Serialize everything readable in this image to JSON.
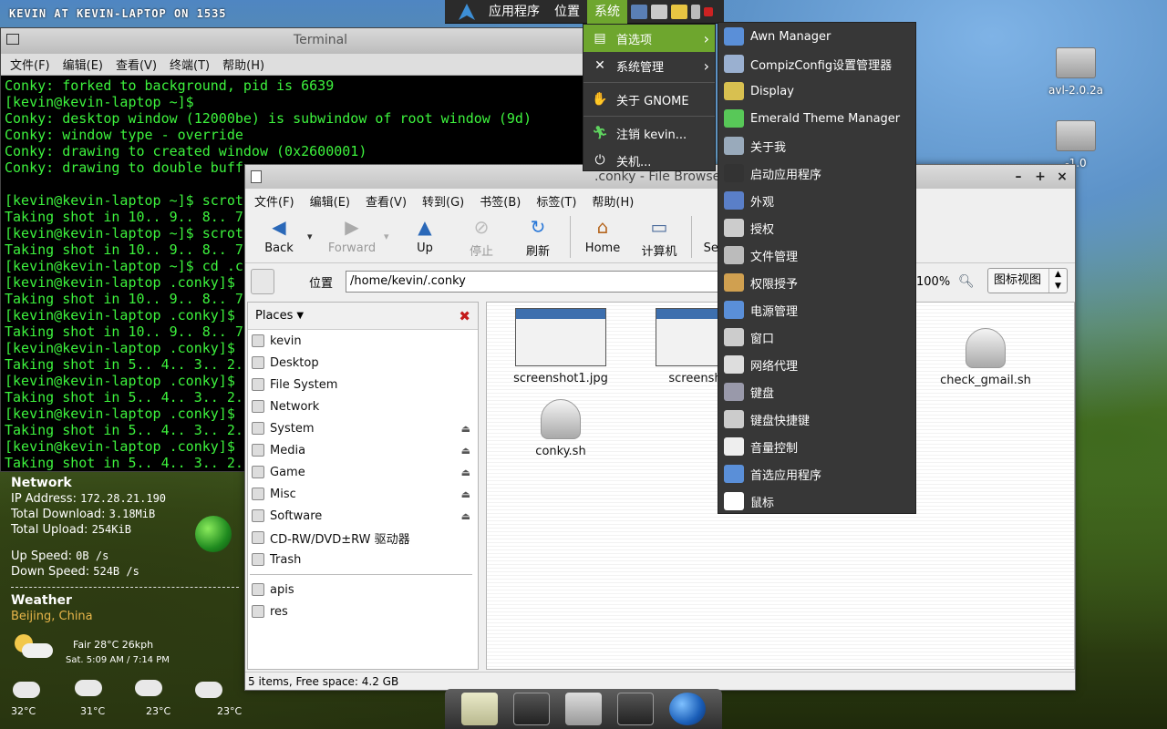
{
  "desktop": {
    "user_label": "KEVIN AT KEVIN-LAPTOP ON 1535"
  },
  "top_panel": {
    "applications": "应用程序",
    "places": "位置",
    "system": "系统"
  },
  "terminal": {
    "title": "Terminal",
    "menu": [
      "文件(F)",
      "编辑(E)",
      "查看(V)",
      "终端(T)",
      "帮助(H)"
    ],
    "lines": [
      "Conky: forked to background, pid is 6639",
      "[kevin@kevin-laptop ~]$",
      "Conky: desktop window (12000be) is subwindow of root window (9d)",
      "Conky: window type - override",
      "Conky: drawing to created window (0x2600001)",
      "Conky: drawing to double buff",
      "",
      "[kevin@kevin-laptop ~]$ scrot",
      "Taking shot in 10.. 9.. 8.. 7",
      "[kevin@kevin-laptop ~]$ scrot",
      "Taking shot in 10.. 9.. 8.. 7",
      "[kevin@kevin-laptop ~]$ cd .c",
      "[kevin@kevin-laptop .conky]$",
      "Taking shot in 10.. 9.. 8.. 7",
      "[kevin@kevin-laptop .conky]$",
      "Taking shot in 10.. 9.. 8.. 7",
      "[kevin@kevin-laptop .conky]$",
      "Taking shot in 5.. 4.. 3.. 2.",
      "[kevin@kevin-laptop .conky]$",
      "Taking shot in 5.. 4.. 3.. 2.",
      "[kevin@kevin-laptop .conky]$",
      "Taking shot in 5.. 4.. 3.. 2.",
      "[kevin@kevin-laptop .conky]$",
      "Taking shot in 5.. 4.. 3.. 2."
    ]
  },
  "conky": {
    "network_header": "Network",
    "ip_label": "IP Address:",
    "ip_value": "172.28.21.190",
    "download_label": "Total Download:",
    "download_value": "3.18MiB",
    "upload_label": "Total Upload:",
    "upload_value": "254KiB",
    "up_speed_label": "Up Speed:",
    "up_speed_value": "0B   /s",
    "down_speed_label": "Down Speed:",
    "down_speed_value": "524B   /s",
    "weather_header": "Weather",
    "location": "Beijing, China",
    "current": "Fair  28°C  26kph",
    "times": "Sat. 5:09 AM / 7:14 PM",
    "forecast": [
      "32°C",
      "31°C",
      "23°C",
      "23°C"
    ]
  },
  "file_browser": {
    "title": ".conky - File Browser",
    "menu": [
      "文件(F)",
      "编辑(E)",
      "查看(V)",
      "转到(G)",
      "书签(B)",
      "标签(T)",
      "帮助(H)"
    ],
    "toolbar": {
      "back": "Back",
      "forward": "Forward",
      "up": "Up",
      "stop": "停止",
      "refresh": "刷新",
      "home": "Home",
      "computer": "计算机",
      "search": "Search"
    },
    "location_label": "位置",
    "location_value": "/home/kevin/.conky",
    "zoom": "100%",
    "view_mode": "图标视图",
    "places_label": "Places",
    "places": [
      {
        "label": "kevin",
        "eject": false
      },
      {
        "label": "Desktop",
        "eject": false
      },
      {
        "label": "File System",
        "eject": false
      },
      {
        "label": "Network",
        "eject": false
      },
      {
        "label": "System",
        "eject": true
      },
      {
        "label": "Media",
        "eject": true
      },
      {
        "label": "Game",
        "eject": true
      },
      {
        "label": "Misc",
        "eject": true
      },
      {
        "label": "Software",
        "eject": true
      },
      {
        "label": "CD-RW/DVD±RW 驱动器",
        "eject": false
      },
      {
        "label": "Trash",
        "eject": false
      }
    ],
    "bookmarks": [
      "apis",
      "res"
    ],
    "files": [
      "screenshot1.jpg",
      "screenshot",
      "check_gmail.sh",
      "conky.sh"
    ],
    "status": "5 items, Free space: 4.2 GB"
  },
  "system_menu": {
    "items": [
      "首选项",
      "系统管理",
      "关于 GNOME",
      "注销 kevin...",
      "关机..."
    ]
  },
  "preferences_menu": {
    "items": [
      "Awn Manager",
      "CompizConfig设置管理器",
      "Display",
      "Emerald Theme Manager",
      "关于我",
      "启动应用程序",
      "外观",
      "授权",
      "文件管理",
      "权限授予",
      "电源管理",
      "窗口",
      "网络代理",
      "键盘",
      "键盘快捷键",
      "音量控制",
      "首选应用程序",
      "鼠标"
    ]
  },
  "desktop_icons": [
    "avl-2.0.2a",
    "-1.0"
  ]
}
